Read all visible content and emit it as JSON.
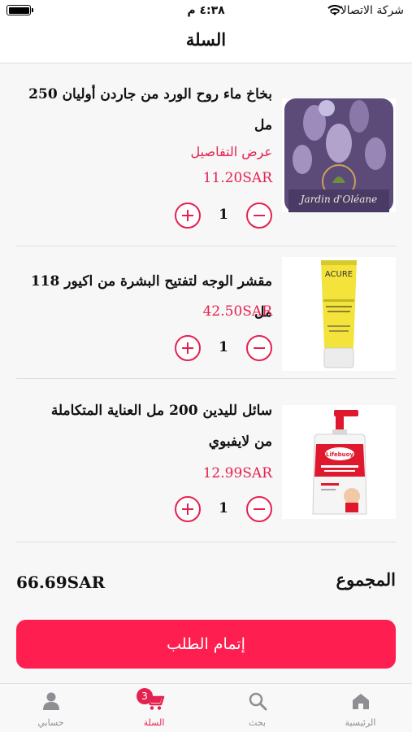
{
  "status_bar": {
    "carrier": "شركة الاتصالات",
    "time": "٤:٣٨ م"
  },
  "header": {
    "title": "السلة"
  },
  "cart": {
    "items": [
      {
        "name": "بخاخ ماء روح الورد من جاردن أوليان 250 مل",
        "details_link": "عرض التفاصيل",
        "price": "11.20SAR",
        "quantity": "1",
        "image": "rose-water-spray",
        "image_brand": "Jardin d'Oléane"
      },
      {
        "name": "مقشر الوجه لتفتيح البشرة من اكيور 118 مل",
        "details_link": "",
        "price": "42.50SAR",
        "quantity": "1",
        "image": "facial-scrub-tube",
        "image_brand": "ACURE"
      },
      {
        "name": "سائل لليدين 200 مل العناية المتكاملة من لايفبوي",
        "details_link": "",
        "price": "12.99SAR",
        "quantity": "1",
        "image": "hand-wash-pump",
        "image_brand": "Lifebuoy"
      }
    ]
  },
  "summary": {
    "total_label": "المجموع",
    "total_value": "66.69SAR"
  },
  "checkout": {
    "label": "إتمام الطلب"
  },
  "tabs": [
    {
      "label": "الرئيسية",
      "icon": "home-icon"
    },
    {
      "label": "بحث",
      "icon": "search-icon"
    },
    {
      "label": "السلة",
      "icon": "cart-icon",
      "badge": "3",
      "active": true
    },
    {
      "label": "حسابي",
      "icon": "account-icon"
    }
  ],
  "colors": {
    "accent": "#e5214f",
    "button": "#fe1e4f"
  }
}
